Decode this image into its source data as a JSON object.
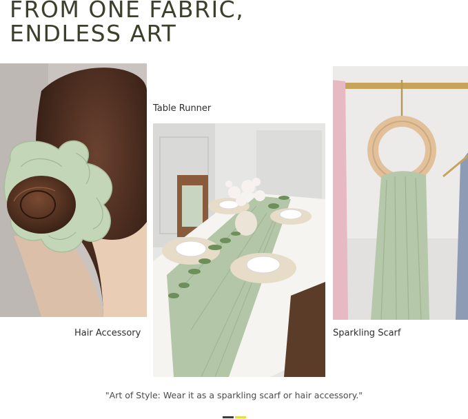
{
  "header": {
    "title_line1": "FROM ONE FABRIC,",
    "title_line2": "ENDLESS ART"
  },
  "cards": [
    {
      "label": "Hair Accessory",
      "image": "sage-green-fabric-scrunchie-in-hair-bun"
    },
    {
      "label": "Table Runner",
      "image": "sage-green-table-runner-on-dining-table"
    },
    {
      "label": "Sparkling Scarf",
      "image": "sage-green-scarf-hanging-on-wooden-ring"
    }
  ],
  "footer": {
    "quote": "\"Art of Style: Wear it as a sparkling scarf or hair accessory.\""
  },
  "pager": {
    "colors": [
      "#3d3d3d",
      "#e2dc4e"
    ]
  },
  "colors": {
    "sage": "#b7c9ad",
    "title": "#3b3f2c"
  }
}
